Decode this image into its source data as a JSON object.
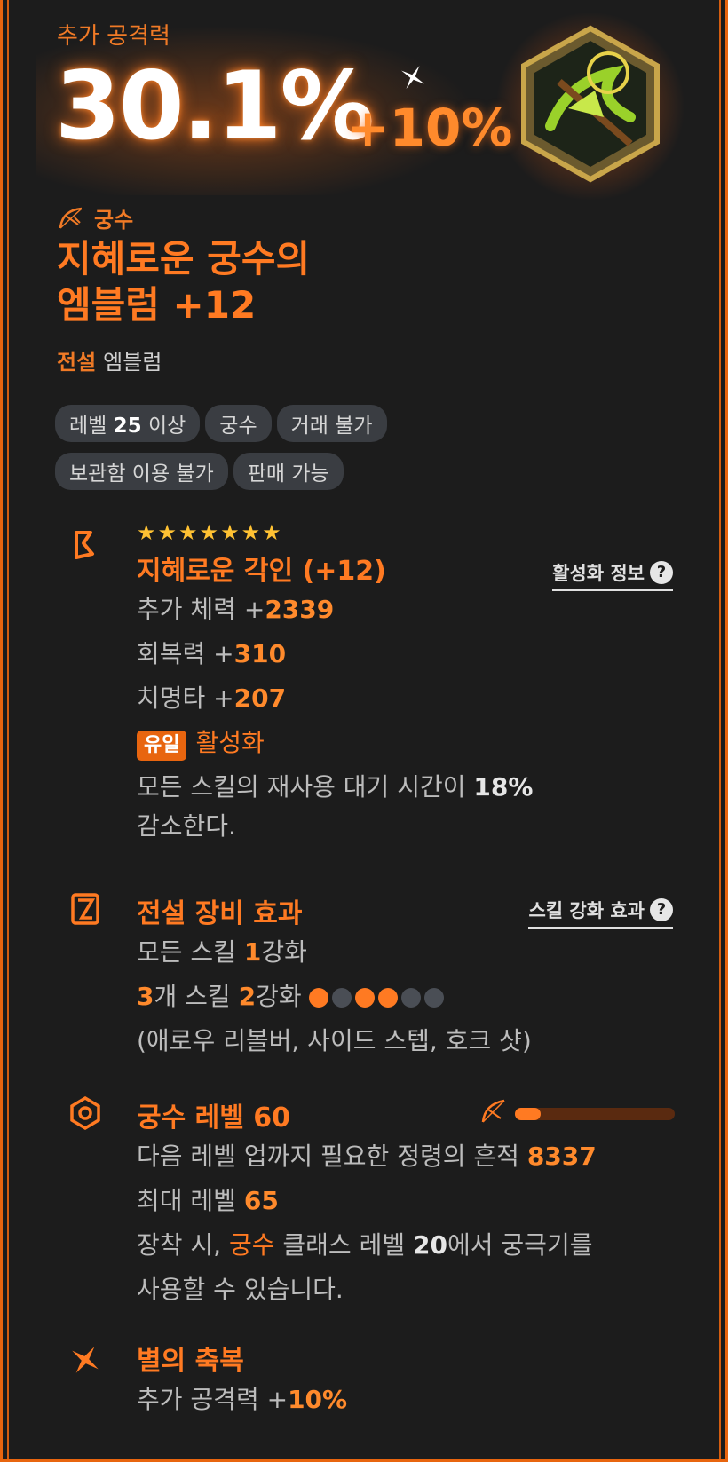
{
  "header": {
    "stat_label": "추가 공격력",
    "stat_value": "30.1%",
    "stat_bonus": "+10%"
  },
  "item": {
    "class_name": "궁수",
    "name_line1": "지혜로운 궁수의",
    "name_line2": "엠블럼 +12",
    "grade_label": "전설",
    "grade_type": "엠블럼"
  },
  "tags": [
    {
      "prefix": "레벨 ",
      "bold": "25",
      "suffix": " 이상"
    },
    {
      "prefix": "궁수",
      "bold": "",
      "suffix": ""
    },
    {
      "prefix": "거래 불가",
      "bold": "",
      "suffix": ""
    },
    {
      "prefix": "보관함 이용 불가",
      "bold": "",
      "suffix": ""
    },
    {
      "prefix": "판매 가능",
      "bold": "",
      "suffix": ""
    }
  ],
  "engrave": {
    "stars": "★★★★★★★",
    "title": "지혜로운 각인 (+12)",
    "info_link": "활성화 정보",
    "stats": [
      {
        "label": "추가 체력 +",
        "value": "2339"
      },
      {
        "label": "회복력 +",
        "value": "310"
      },
      {
        "label": "치명타 +",
        "value": "207"
      }
    ],
    "unique_badge": "유일",
    "activate_label": "활성화",
    "desc_pre": "모든 스킬의 재사용 대기 시간이 ",
    "desc_val": "18%",
    "desc_post": "감소한다."
  },
  "legend_effect": {
    "title": "전설 장비 효과",
    "link": "스킬 강화 효과",
    "l1_pre": "모든 스킬 ",
    "l1_val": "1",
    "l1_post": "강화",
    "l2_val1": "3",
    "l2_mid": "개 스킬 ",
    "l2_val2": "2",
    "l2_post": "강화",
    "dots": [
      true,
      false,
      true,
      true,
      false,
      false
    ],
    "skills": "(애로우 리볼버, 사이드 스텝, 호크 샷)"
  },
  "class_level": {
    "title": "궁수 레벨 60",
    "progress": 0.16,
    "l1_pre": "다음 레벨 업까지 필요한 정령의 흔적 ",
    "l1_val": "8337",
    "l2_pre": "최대 레벨 ",
    "l2_val": "65",
    "l3_pre": "장착 시, ",
    "l3_class": "궁수",
    "l3_mid": " 클래스 레벨 ",
    "l3_val": "20",
    "l3_post": "에서 궁극기를",
    "l4": "사용할 수 있습니다."
  },
  "star_blessing": {
    "title": "별의 축복",
    "pre": "추가 공격력 +",
    "val": "10%"
  },
  "colors": {
    "accent": "#ff7a22",
    "frame": "#e8650f",
    "bg": "#1c1c1c",
    "star": "#ffc233"
  }
}
